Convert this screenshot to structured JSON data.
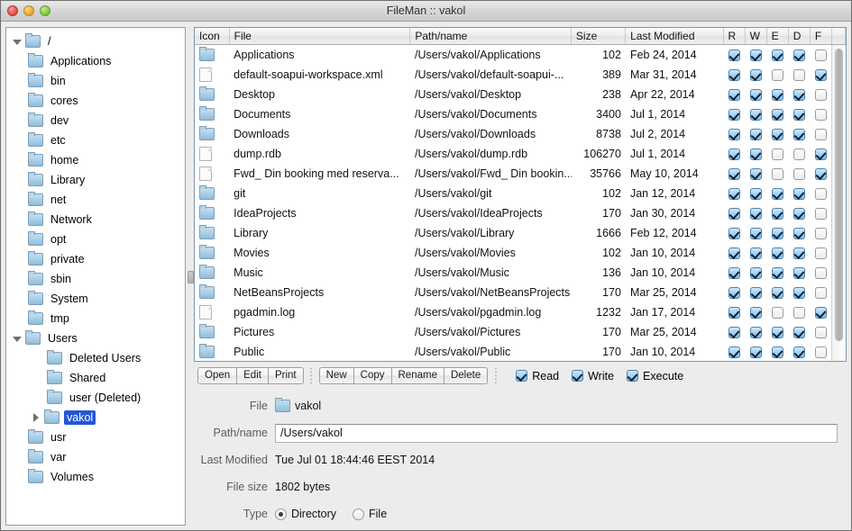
{
  "window": {
    "title": "FileMan :: vakol",
    "controls": [
      "close-button",
      "minimize-button",
      "zoom-button"
    ]
  },
  "tree": {
    "nodes": [
      {
        "label": "/",
        "level": 0,
        "icon": "folder-icon",
        "twist": "open",
        "selected": false
      },
      {
        "label": "Applications",
        "level": 1,
        "icon": "folder-icon",
        "twist": "none",
        "selected": false
      },
      {
        "label": "bin",
        "level": 1,
        "icon": "folder-icon",
        "twist": "none",
        "selected": false
      },
      {
        "label": "cores",
        "level": 1,
        "icon": "folder-icon",
        "twist": "none",
        "selected": false
      },
      {
        "label": "dev",
        "level": 1,
        "icon": "folder-icon",
        "twist": "none",
        "selected": false
      },
      {
        "label": "etc",
        "level": 1,
        "icon": "folder-icon",
        "twist": "none",
        "selected": false
      },
      {
        "label": "home",
        "level": 1,
        "icon": "folder-icon",
        "twist": "none",
        "selected": false
      },
      {
        "label": "Library",
        "level": 1,
        "icon": "folder-icon",
        "twist": "none",
        "selected": false
      },
      {
        "label": "net",
        "level": 1,
        "icon": "folder-icon",
        "twist": "none",
        "selected": false
      },
      {
        "label": "Network",
        "level": 1,
        "icon": "folder-icon",
        "twist": "none",
        "selected": false
      },
      {
        "label": "opt",
        "level": 1,
        "icon": "folder-icon",
        "twist": "none",
        "selected": false
      },
      {
        "label": "private",
        "level": 1,
        "icon": "folder-icon",
        "twist": "none",
        "selected": false
      },
      {
        "label": "sbin",
        "level": 1,
        "icon": "folder-icon",
        "twist": "none",
        "selected": false
      },
      {
        "label": "System",
        "level": 1,
        "icon": "folder-icon",
        "twist": "none",
        "selected": false
      },
      {
        "label": "tmp",
        "level": 1,
        "icon": "folder-icon",
        "twist": "none",
        "selected": false
      },
      {
        "label": "Users",
        "level": 1,
        "icon": "folder-icon",
        "twist": "open",
        "selected": false
      },
      {
        "label": "Deleted Users",
        "level": 2,
        "icon": "folder-icon",
        "twist": "none",
        "selected": false
      },
      {
        "label": "Shared",
        "level": 2,
        "icon": "folder-icon",
        "twist": "none",
        "selected": false
      },
      {
        "label": "user (Deleted)",
        "level": 2,
        "icon": "folder-icon",
        "twist": "none",
        "selected": false
      },
      {
        "label": "vakol",
        "level": 2,
        "icon": "folder-icon",
        "twist": "closed",
        "selected": true
      },
      {
        "label": "usr",
        "level": 1,
        "icon": "folder-icon",
        "twist": "none",
        "selected": false
      },
      {
        "label": "var",
        "level": 1,
        "icon": "folder-icon",
        "twist": "none",
        "selected": false
      },
      {
        "label": "Volumes",
        "level": 1,
        "icon": "folder-icon",
        "twist": "none",
        "selected": false
      }
    ]
  },
  "table": {
    "columns": [
      "Icon",
      "File",
      "Path/name",
      "Size",
      "Last Modified",
      "R",
      "W",
      "E",
      "D",
      "F"
    ],
    "rows": [
      {
        "icon": "folder-icon",
        "file": "Applications",
        "path": "/Users/vakol/Applications",
        "size": "102",
        "modified": "Feb 24, 2014",
        "r": true,
        "w": true,
        "e": true,
        "d": true,
        "f": false
      },
      {
        "icon": "document-icon",
        "file": "default-soapui-workspace.xml",
        "path": "/Users/vakol/default-soapui-...",
        "size": "389",
        "modified": "Mar 31, 2014",
        "r": true,
        "w": true,
        "e": false,
        "d": false,
        "f": true
      },
      {
        "icon": "folder-icon",
        "file": "Desktop",
        "path": "/Users/vakol/Desktop",
        "size": "238",
        "modified": "Apr 22, 2014",
        "r": true,
        "w": true,
        "e": true,
        "d": true,
        "f": false
      },
      {
        "icon": "folder-icon",
        "file": "Documents",
        "path": "/Users/vakol/Documents",
        "size": "3400",
        "modified": "Jul 1, 2014",
        "r": true,
        "w": true,
        "e": true,
        "d": true,
        "f": false
      },
      {
        "icon": "folder-icon",
        "file": "Downloads",
        "path": "/Users/vakol/Downloads",
        "size": "8738",
        "modified": "Jul 2, 2014",
        "r": true,
        "w": true,
        "e": true,
        "d": true,
        "f": false
      },
      {
        "icon": "document-icon",
        "file": "dump.rdb",
        "path": "/Users/vakol/dump.rdb",
        "size": "106270",
        "modified": "Jul 1, 2014",
        "r": true,
        "w": true,
        "e": false,
        "d": false,
        "f": true
      },
      {
        "icon": "document-icon",
        "file": "Fwd_ Din booking med reserva...",
        "path": "/Users/vakol/Fwd_ Din bookin...",
        "size": "35766",
        "modified": "May 10, 2014",
        "r": true,
        "w": true,
        "e": false,
        "d": false,
        "f": true
      },
      {
        "icon": "folder-icon",
        "file": "git",
        "path": "/Users/vakol/git",
        "size": "102",
        "modified": "Jan 12, 2014",
        "r": true,
        "w": true,
        "e": true,
        "d": true,
        "f": false
      },
      {
        "icon": "folder-icon",
        "file": "IdeaProjects",
        "path": "/Users/vakol/IdeaProjects",
        "size": "170",
        "modified": "Jan 30, 2014",
        "r": true,
        "w": true,
        "e": true,
        "d": true,
        "f": false
      },
      {
        "icon": "folder-icon",
        "file": "Library",
        "path": "/Users/vakol/Library",
        "size": "1666",
        "modified": "Feb 12, 2014",
        "r": true,
        "w": true,
        "e": true,
        "d": true,
        "f": false
      },
      {
        "icon": "folder-icon",
        "file": "Movies",
        "path": "/Users/vakol/Movies",
        "size": "102",
        "modified": "Jan 10, 2014",
        "r": true,
        "w": true,
        "e": true,
        "d": true,
        "f": false
      },
      {
        "icon": "folder-icon",
        "file": "Music",
        "path": "/Users/vakol/Music",
        "size": "136",
        "modified": "Jan 10, 2014",
        "r": true,
        "w": true,
        "e": true,
        "d": true,
        "f": false
      },
      {
        "icon": "folder-icon",
        "file": "NetBeansProjects",
        "path": "/Users/vakol/NetBeansProjects",
        "size": "170",
        "modified": "Mar 25, 2014",
        "r": true,
        "w": true,
        "e": true,
        "d": true,
        "f": false
      },
      {
        "icon": "document-icon",
        "file": "pgadmin.log",
        "path": "/Users/vakol/pgadmin.log",
        "size": "1232",
        "modified": "Jan 17, 2014",
        "r": true,
        "w": true,
        "e": false,
        "d": false,
        "f": true
      },
      {
        "icon": "folder-icon",
        "file": "Pictures",
        "path": "/Users/vakol/Pictures",
        "size": "170",
        "modified": "Mar 25, 2014",
        "r": true,
        "w": true,
        "e": true,
        "d": true,
        "f": false
      },
      {
        "icon": "folder-icon",
        "file": "Public",
        "path": "/Users/vakol/Public",
        "size": "170",
        "modified": "Jan 10, 2014",
        "r": true,
        "w": true,
        "e": true,
        "d": true,
        "f": false
      }
    ]
  },
  "toolbar": {
    "group_file": [
      "Open",
      "Edit",
      "Print"
    ],
    "group_edit": [
      "New",
      "Copy",
      "Rename",
      "Delete"
    ],
    "permissions": [
      {
        "label": "Read",
        "checked": true
      },
      {
        "label": "Write",
        "checked": true
      },
      {
        "label": "Execute",
        "checked": true
      }
    ]
  },
  "detail": {
    "file_label": "File",
    "file_value": "vakol",
    "file_icon": "folder-icon",
    "path_label": "Path/name",
    "path_value": "/Users/vakol",
    "modified_label": "Last Modified",
    "modified_value": "Tue Jul 01 18:44:46 EEST 2014",
    "size_label": "File size",
    "size_value": "1802 bytes",
    "type_label": "Type",
    "type_options": [
      {
        "label": "Directory",
        "selected": true
      },
      {
        "label": "File",
        "selected": false
      }
    ]
  }
}
